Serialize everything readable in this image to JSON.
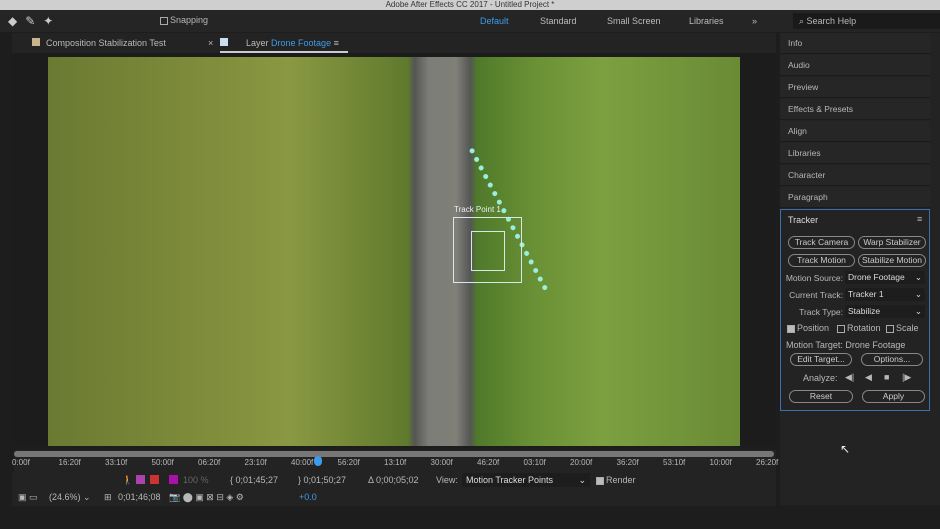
{
  "window_title": "Adobe After Effects CC 2017 - Untitled Project *",
  "toolbar": {
    "snapping": "Snapping",
    "workspaces": [
      "Default",
      "Standard",
      "Small Screen",
      "Libraries"
    ],
    "search": "Search Help"
  },
  "tabs": {
    "comp": "Composition Stabilization Test",
    "layer_prefix": "Layer",
    "layer_name": "Drone Footage"
  },
  "viewer": {
    "track_point": "Track Point 1"
  },
  "ruler": [
    "0:00f",
    "16:20f",
    "33:10f",
    "50:00f",
    "06:20f",
    "23:10f",
    "40:00f",
    "56:20f",
    "13:10f",
    "30:00f",
    "46:20f",
    "03:10f",
    "20:00f",
    "36:20f",
    "53:10f",
    "10:00f",
    "26:20f"
  ],
  "controls": {
    "zoom_pct": "100 %",
    "in": "0;01;45;27",
    "out": "0;01;50;27",
    "duration": "Δ 0;00;05;02",
    "view_label": "View:",
    "view_value": "Motion Tracker Points",
    "render": "Render",
    "magnification": "(24.6%)",
    "timecode": "0;01;46;08",
    "exposure": "+0.0"
  },
  "right_panel": {
    "items": [
      "Info",
      "Audio",
      "Preview",
      "Effects & Presets",
      "Align",
      "Libraries",
      "Character",
      "Paragraph"
    ]
  },
  "tracker": {
    "title": "Tracker",
    "track_camera": "Track Camera",
    "warp_stabilizer": "Warp Stabilizer",
    "track_motion": "Track Motion",
    "stabilize_motion": "Stabilize Motion",
    "motion_source_label": "Motion Source:",
    "motion_source": "Drone Footage",
    "current_track_label": "Current Track:",
    "current_track": "Tracker 1",
    "track_type_label": "Track Type:",
    "track_type": "Stabilize",
    "position": "Position",
    "rotation": "Rotation",
    "scale": "Scale",
    "position_checked": true,
    "motion_target": "Motion Target: Drone Footage",
    "edit_target": "Edit Target...",
    "options": "Options...",
    "analyze_label": "Analyze:",
    "reset": "Reset",
    "apply": "Apply"
  }
}
